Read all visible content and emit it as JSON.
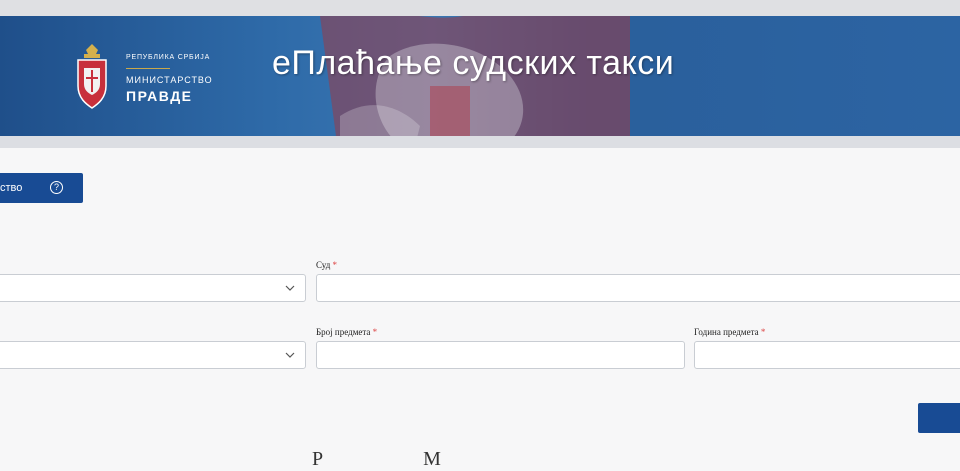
{
  "header": {
    "coat_of_arms_icon": "serbia-coat-of-arms-icon",
    "republic_text": "РЕПУБЛИКА СРБИЈА",
    "ministry_line1": "МИНИСТАРСТВО",
    "ministry_line2": "ПРАВДЕ",
    "app_title": "еПлаћање судских такси"
  },
  "toolbar": {
    "help_button_label": "ство",
    "help_icon": "question-circle-icon"
  },
  "form": {
    "select_one": {
      "value": ""
    },
    "court": {
      "label": "Суд",
      "required_mark": "*",
      "value": ""
    },
    "select_two": {
      "value": ""
    },
    "case_number": {
      "label": "Број предмета",
      "required_mark": "*",
      "value": ""
    },
    "case_year": {
      "label": "Година предмета",
      "required_mark": "*",
      "value": ""
    }
  },
  "footer_text": "Р                    М",
  "colors": {
    "banner_blue": "#2c64a3",
    "button_blue": "#184b94",
    "required_red": "#d44444"
  }
}
